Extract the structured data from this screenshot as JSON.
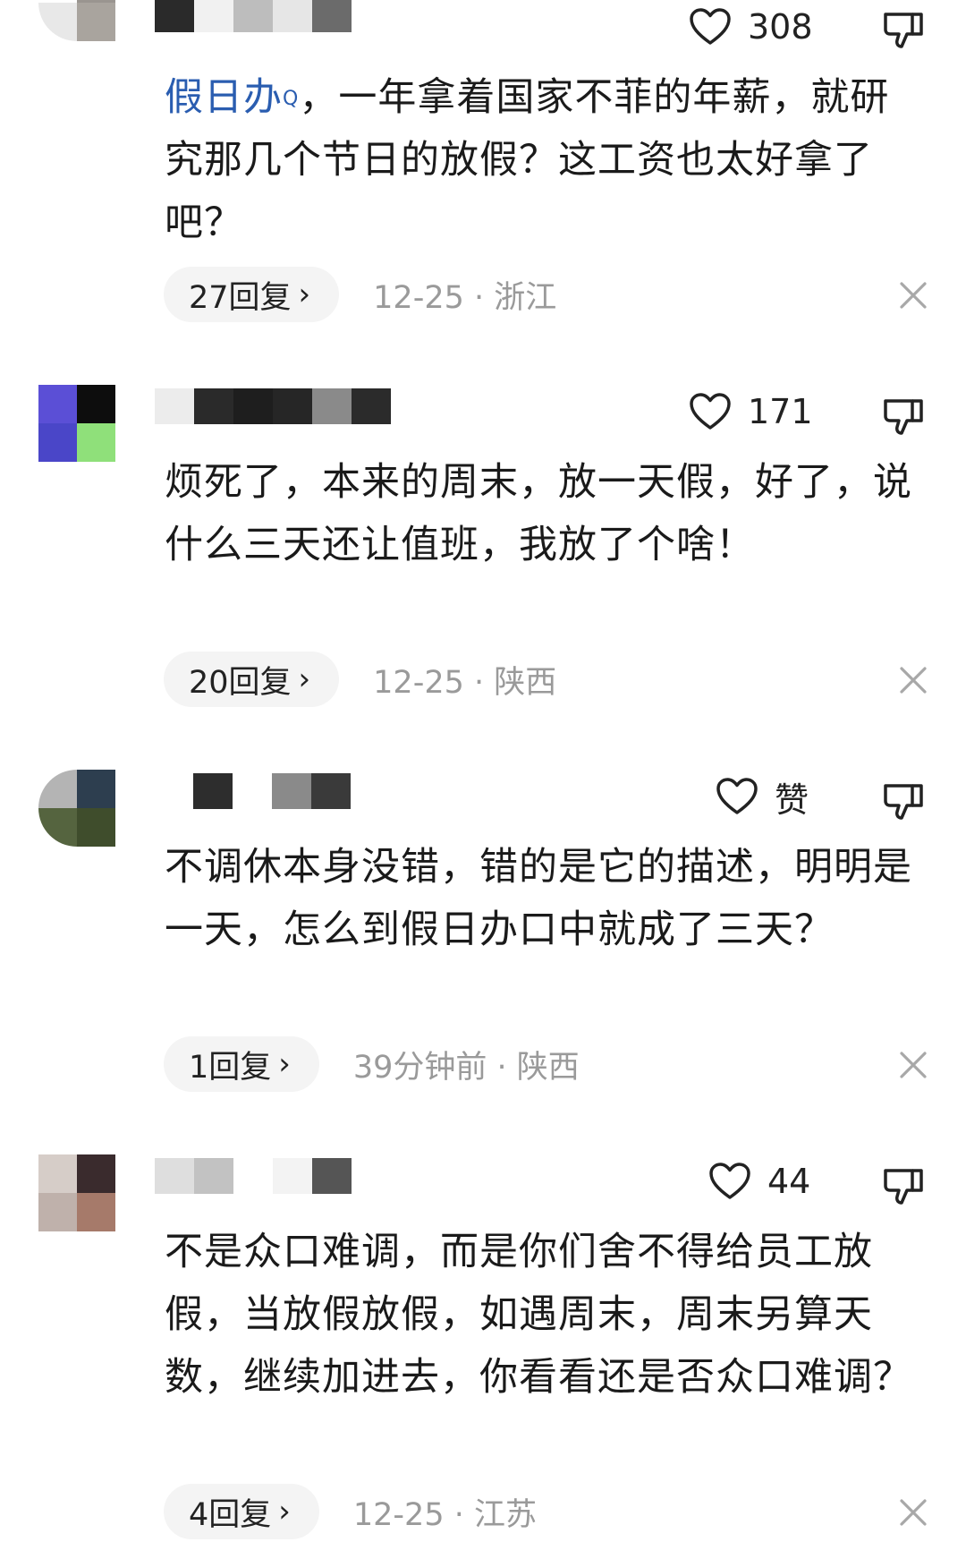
{
  "comments": [
    {
      "avatar_colors": [
        "#e8e8e8",
        "#9a9590",
        "#f2f2f2",
        "#a9a49e"
      ],
      "name_colors": [
        "#2a2a2a",
        "#f1f1f1",
        "#bdbdbd",
        "#e6e6e6",
        "#6b6b6b"
      ],
      "likes": "308",
      "tag": "假日办",
      "tag_mark": "Q",
      "text": "，一年拿着国家不菲的年薪，就研究那几个节日的放假？这工资也太好拿了吧？",
      "replies": "27回复",
      "meta": "12-25 · 浙江"
    },
    {
      "avatar_colors": [
        "#5b4fd6",
        "#0d0d0d",
        "#4a46c8",
        "#8fe07a"
      ],
      "name_colors": [
        "#ececec",
        "#2a2a2a",
        "#1e1e1e",
        "#262626",
        "#8a8a8a",
        "#2b2b2b"
      ],
      "likes": "171",
      "text": "烦死了，本来的周末，放一天假，好了，说什么三天还让值班，我放了个啥！",
      "replies": "20回复",
      "meta": "12-25 · 陕西"
    },
    {
      "avatar_colors": [
        "#b4b4b4",
        "#2d3e4f",
        "#55643f",
        "#3f4d2c"
      ],
      "name_colors": [
        "#2d2d2d",
        "#ffffff",
        "#8a8a8a",
        "#3a3a3a"
      ],
      "likes": "赞",
      "text": "不调休本身没错，错的是它的描述，明明是一天，怎么到假日办口中就成了三天？",
      "replies": "1回复",
      "meta": "39分钟前 · 陕西"
    },
    {
      "avatar_colors": [
        "#d6cdc8",
        "#3a2b2d",
        "#bfb1ab",
        "#a67a6a"
      ],
      "name_colors": [
        "#dedede",
        "#c2c2c2",
        "#ffffff",
        "#f3f3f3",
        "#555555"
      ],
      "likes": "44",
      "text": "不是众口难调，而是你们舍不得给员工放假，当放假放假，如遇周末，周末另算天数，继续加进去，你看看还是否众口难调？",
      "replies": "4回复",
      "meta": "12-25 · 江苏"
    }
  ]
}
